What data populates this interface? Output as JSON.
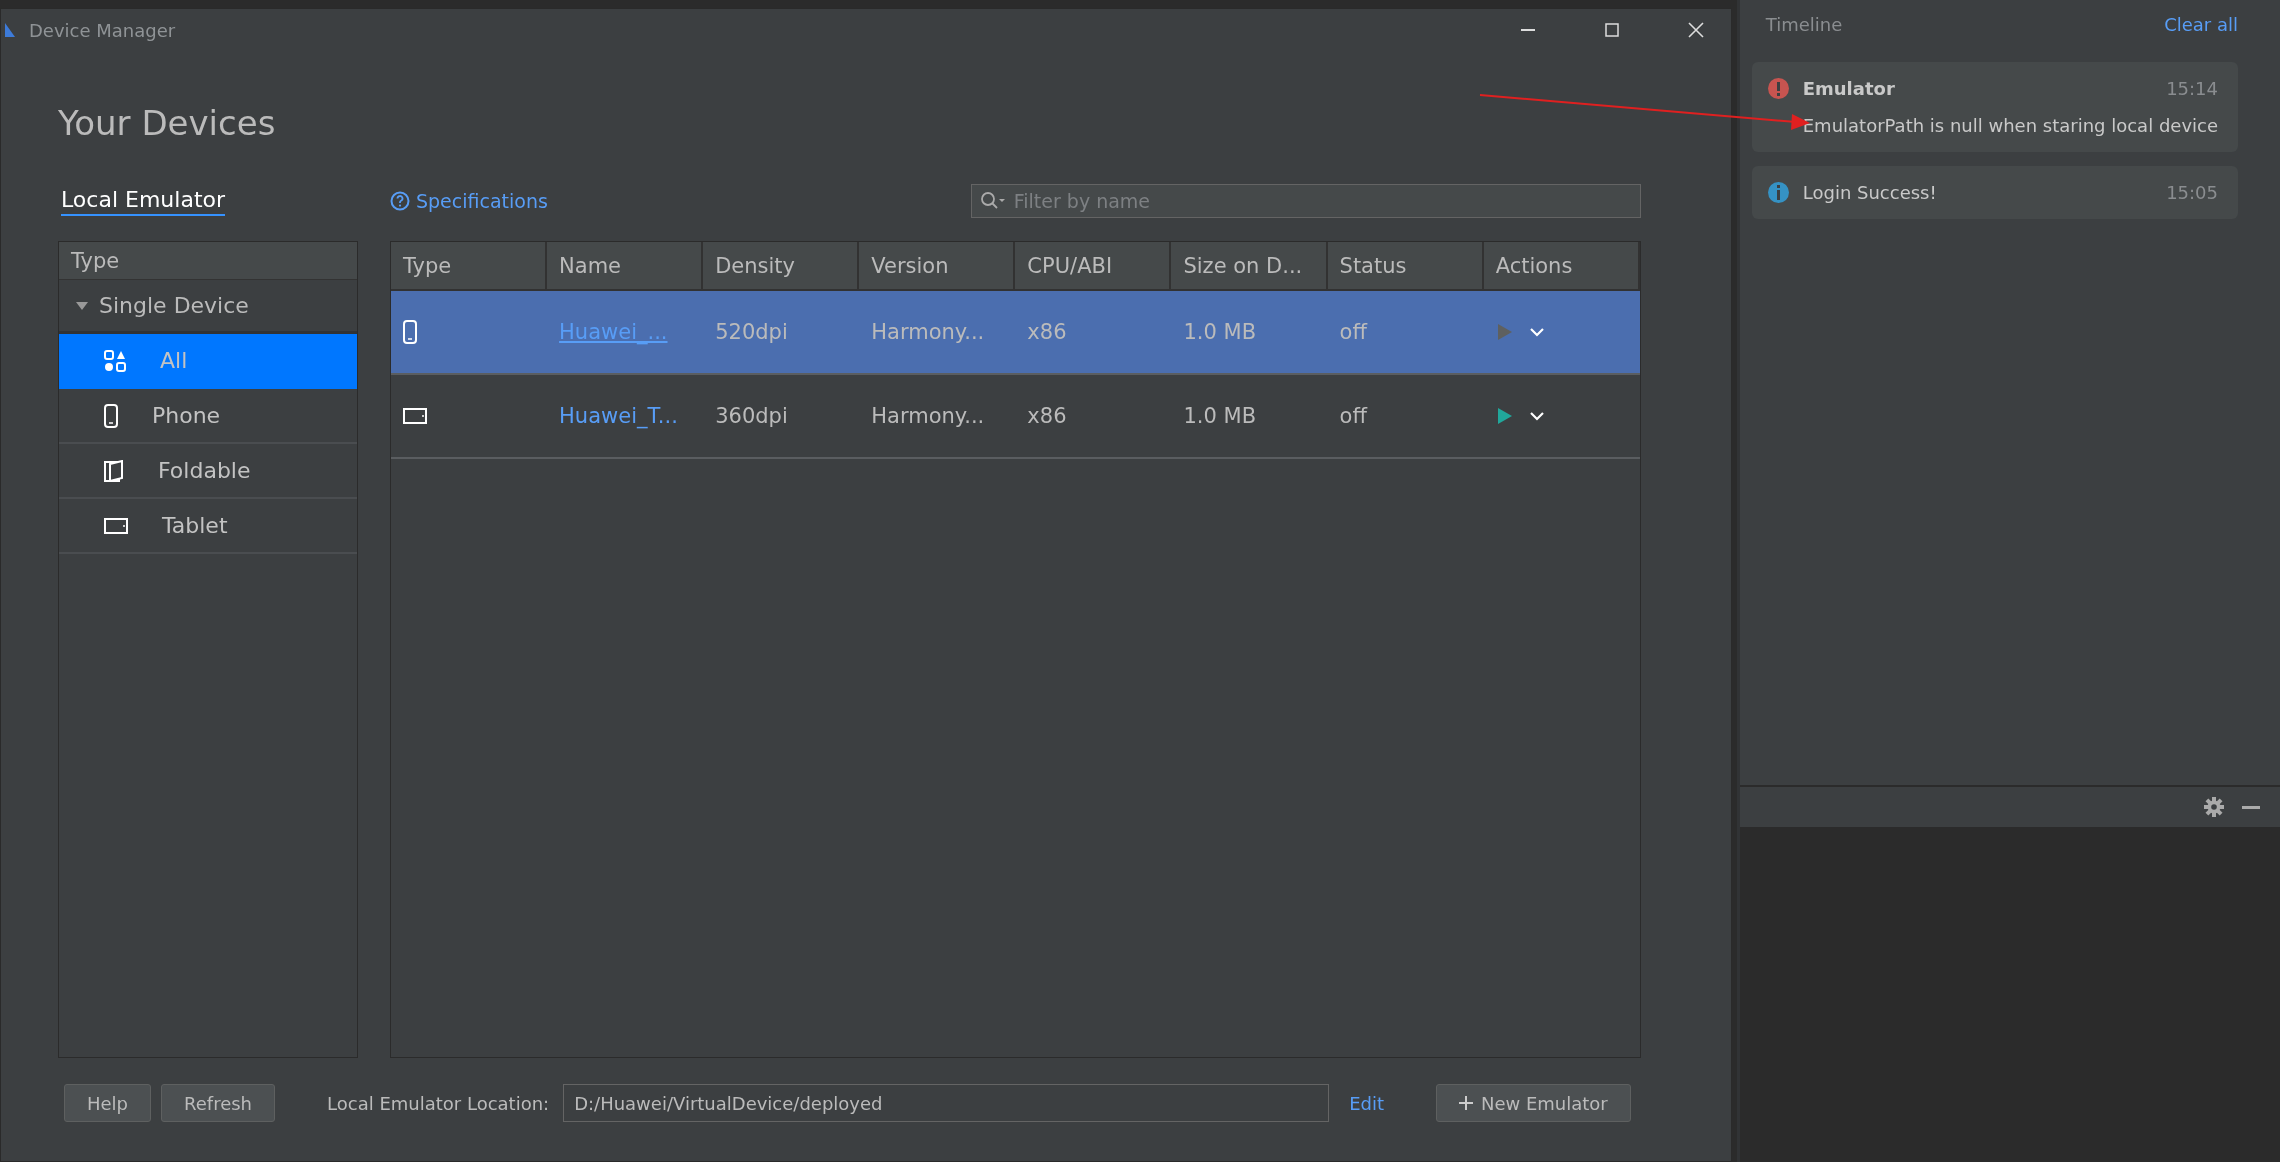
{
  "window": {
    "title": "Device Manager"
  },
  "heading": "Your Devices",
  "tabs": [
    {
      "label": "Local Emulator",
      "selected": true
    }
  ],
  "specifications_link": "Specifications",
  "filter": {
    "placeholder": "Filter by name"
  },
  "type_tree": {
    "header": "Type",
    "nodes": [
      {
        "label": "Single Device",
        "expanded": true,
        "children": [
          {
            "label": "All",
            "kind": "all",
            "selected": true
          },
          {
            "label": "Phone",
            "kind": "phone",
            "selected": false
          },
          {
            "label": "Foldable",
            "kind": "foldable",
            "selected": false
          },
          {
            "label": "Tablet",
            "kind": "tablet",
            "selected": false
          }
        ]
      }
    ]
  },
  "table": {
    "columns": [
      "Type",
      "Name",
      "Density",
      "Version",
      "CPU/ABI",
      "Size on D...",
      "Status",
      "Actions"
    ],
    "rows": [
      {
        "kind": "phone",
        "selected": true,
        "name": "Huawei_...",
        "density": "520dpi",
        "version": "Harmony...",
        "cpu": "x86",
        "size": "1.0 MB",
        "status": "off",
        "run_enabled": false
      },
      {
        "kind": "tablet",
        "selected": false,
        "name": "Huawei_T...",
        "density": "360dpi",
        "version": "Harmony...",
        "cpu": "x86",
        "size": "1.0 MB",
        "status": "off",
        "run_enabled": true
      }
    ]
  },
  "footer": {
    "buttons": [
      "Help",
      "Refresh"
    ],
    "location_label": "Local Emulator Location:",
    "location_value": "D:/Huawei/VirtualDevice/deployed",
    "edit_link": "Edit",
    "new_button": "New Emulator"
  },
  "timeline": {
    "title": "Timeline",
    "clear_all": "Clear all",
    "notifications": [
      {
        "kind": "error",
        "title": "Emulator",
        "time": "15:14",
        "message": "EmulatorPath is null when staring local device"
      },
      {
        "kind": "info",
        "message": "Login Success!",
        "time": "15:05"
      }
    ]
  }
}
